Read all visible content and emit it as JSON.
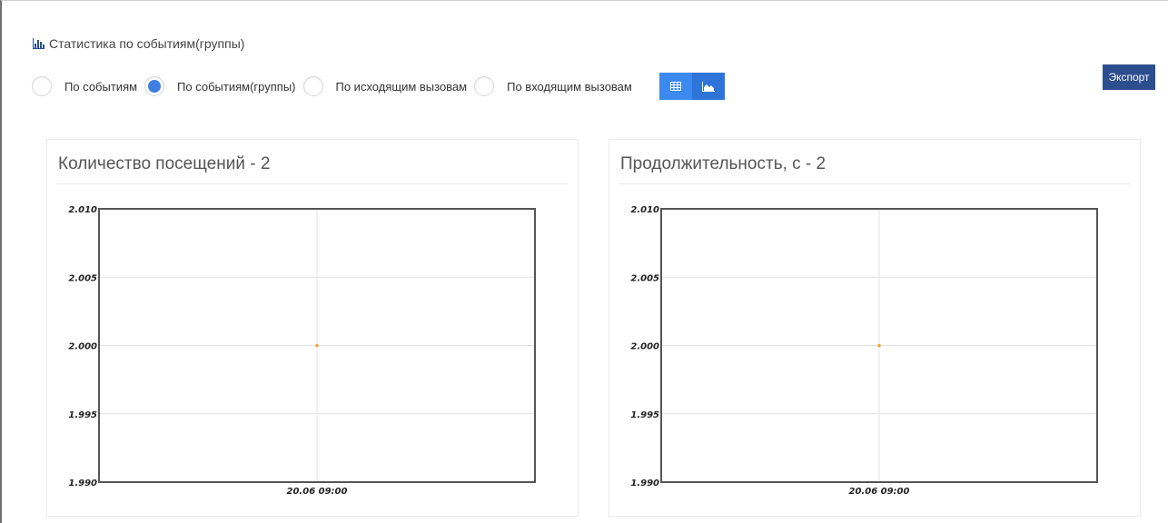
{
  "header": {
    "title": "Статистика по событиям(группы)",
    "icon": "bar-chart-icon"
  },
  "filters": {
    "options": [
      {
        "label": "По событиям",
        "checked": false
      },
      {
        "label": "По событиям(группы)",
        "checked": true
      },
      {
        "label": "По исходящим вызовам",
        "checked": false
      },
      {
        "label": "По входящим вызовам",
        "checked": false
      }
    ],
    "view_buttons": [
      {
        "icon": "table-icon",
        "active": false
      },
      {
        "icon": "area-chart-icon",
        "active": true
      }
    ]
  },
  "export_label": "Экспорт",
  "colors": {
    "accent": "#3c8af0",
    "export": "#2c4e8f",
    "radio_checked": "#3c7fe0",
    "point": "#f0a830"
  },
  "chart_data": [
    {
      "type": "line",
      "title": "Количество посещений - 2",
      "x_labels": [
        "20.06 09:00"
      ],
      "y_ticks": [
        "2.010",
        "2.005",
        "2.000",
        "1.995",
        "1.990"
      ],
      "ylim": [
        1.99,
        2.01
      ],
      "series": [
        {
          "x": [
            "20.06 09:00"
          ],
          "values": [
            2
          ]
        }
      ],
      "grid": true
    },
    {
      "type": "line",
      "title": "Продолжительность, с - 2",
      "x_labels": [
        "20.06 09:00"
      ],
      "y_ticks": [
        "2.010",
        "2.005",
        "2.000",
        "1.995",
        "1.990"
      ],
      "ylim": [
        1.99,
        2.01
      ],
      "series": [
        {
          "x": [
            "20.06 09:00"
          ],
          "values": [
            2
          ]
        }
      ],
      "grid": true
    }
  ]
}
